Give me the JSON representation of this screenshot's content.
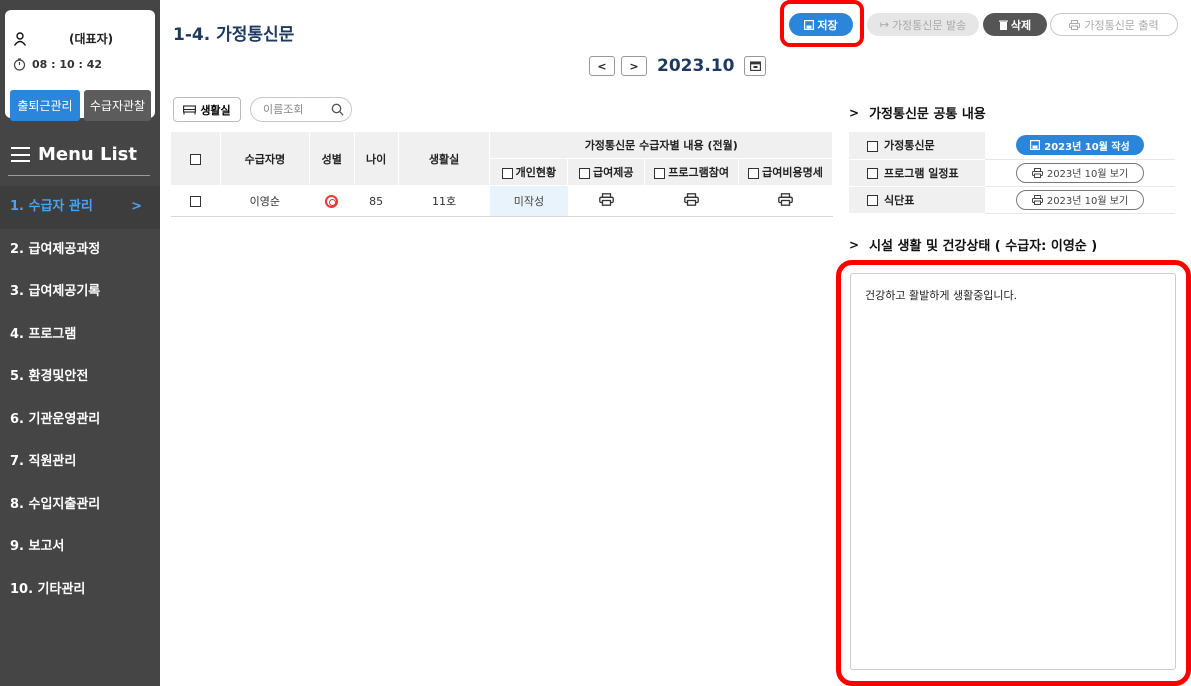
{
  "user": {
    "role": "(대표자)",
    "time": "08 : 10 : 42",
    "attendance_button": "출퇴근관리",
    "observe_button": "수급자관찰"
  },
  "menu": {
    "title": "Menu List",
    "items": [
      {
        "label": "1. 수급자 관리",
        "active": true
      },
      {
        "label": "2. 급여제공과정"
      },
      {
        "label": "3. 급여제공기록"
      },
      {
        "label": "4. 프로그램"
      },
      {
        "label": "5. 환경및안전"
      },
      {
        "label": "6. 기관운영관리"
      },
      {
        "label": "7. 직원관리"
      },
      {
        "label": "8. 수입지출관리"
      },
      {
        "label": "9. 보고서"
      },
      {
        "label": "10. 기타관리"
      }
    ],
    "active_chevron": ">"
  },
  "page": {
    "title": "1-4. 가정통신문"
  },
  "toolbar": {
    "save": "저장",
    "send": "가정통신문 발송",
    "delete": "삭제",
    "print": "가정통신문 출력"
  },
  "date_nav": {
    "prev": "<",
    "next": ">",
    "current": "2023.10"
  },
  "filter": {
    "room_button": "생활실",
    "search_placeholder": "이름조회"
  },
  "table": {
    "headers": {
      "name": "수급자명",
      "gender": "성별",
      "age": "나이",
      "room": "생활실",
      "group": "가정통신문 수급자별 내용 (전월)",
      "sub": [
        "개인현황",
        "급여제공",
        "프로그램참여",
        "급여비용명세"
      ]
    },
    "rows": [
      {
        "name": "이영순",
        "gender_icon": "female-icon",
        "age": "85",
        "room": "11호",
        "status": "미작성"
      }
    ]
  },
  "common": {
    "title": "가정통신문 공통 내용",
    "rows": [
      {
        "label": "가정통신문",
        "action": "2023년 10월 작성",
        "style": "primary"
      },
      {
        "label": "프로그램 일정표",
        "action": "2023년 10월 보기",
        "style": "outline"
      },
      {
        "label": "식단표",
        "action": "2023년 10월 보기",
        "style": "outline"
      }
    ]
  },
  "health": {
    "title": "시설 생활 및 건강상태 ( 수급자: 이영순 )",
    "content": "건강하고 활발하게 생활중입니다."
  },
  "colors": {
    "accent": "#2b86d9",
    "highlight": "#ff0000",
    "sidebar": "#454545",
    "title": "#1e3a5f"
  }
}
